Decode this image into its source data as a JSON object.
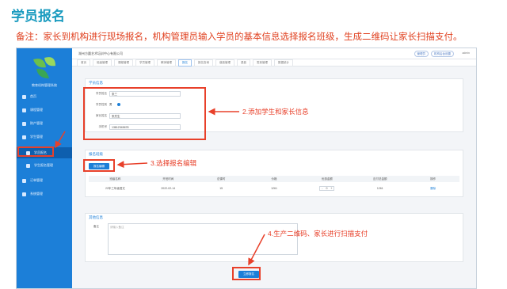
{
  "header": {
    "title": "学员报名",
    "note": "备注：家长到机构进行现场报名，机构管理员输入学员的基本信息选择报名班级，生成二维码让家长扫描支付。"
  },
  "app": {
    "org_name": "湖州方圆艺术培训中心有限公司",
    "system_name": "教育机构管理系统",
    "topbar": {
      "pill1": "管理员",
      "pill2": "机构后台设置",
      "user": "admin"
    },
    "tabs": [
      "首页",
      "班级管理",
      "课程管理",
      "学员管理",
      "教师管理",
      "报名",
      "报名查询",
      "缴费管理",
      "退费",
      "签到管理",
      "数据统计"
    ],
    "active_tab": "报名",
    "sidebar": [
      {
        "label": "首页"
      },
      {
        "label": "课程管理"
      },
      {
        "label": "财产管理"
      },
      {
        "label": "学生管理"
      },
      {
        "label": "学员报名"
      },
      {
        "label": "学生报名管理"
      },
      {
        "label": "订单管理"
      },
      {
        "label": "系统管理"
      }
    ]
  },
  "student_form": {
    "title": "学员信息",
    "fields": [
      {
        "label": "学员姓名",
        "value": "张三"
      },
      {
        "label": "学员性别",
        "value": "男"
      },
      {
        "label": "家长姓名",
        "value": "张先生"
      },
      {
        "label": "手机号",
        "value": "13812345678"
      }
    ],
    "gender_options": [
      "男",
      "女"
    ]
  },
  "class_section": {
    "title": "报名班级",
    "edit_button": "报名编辑",
    "columns": [
      "班级名称",
      "开班时间",
      "总课时",
      "价格",
      "优惠金额",
      "应付总金额",
      "操作"
    ],
    "rows": [
      {
        "name": "22年三年级语文",
        "start": "2022-02-14",
        "hours": "15",
        "price": "1261",
        "discount": "0",
        "total": "1261",
        "action": "删除"
      }
    ]
  },
  "remark_section": {
    "title": "其他信息",
    "label": "备注",
    "placeholder": "请输入备注"
  },
  "submit_button": "立即报名",
  "annotations": {
    "a2": "2.添加学生和家长信息",
    "a3": "3.选择报名编辑",
    "a4": "4.生产二维码、家长进行扫描支付"
  },
  "colors": {
    "accent": "#1c7fd8",
    "annotation": "#e8402a",
    "title": "#1a9bbf"
  }
}
